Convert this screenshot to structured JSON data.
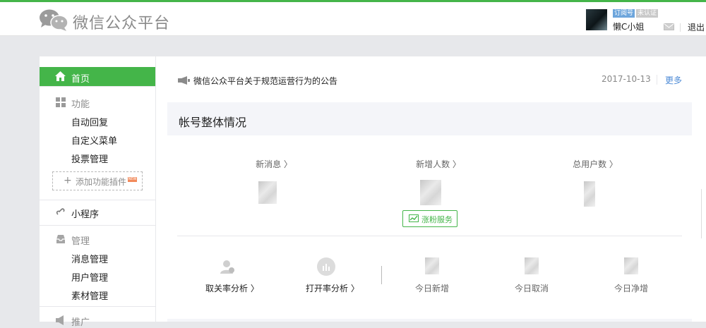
{
  "header": {
    "logo_text": "微信公众平台",
    "account_type_badge": "订阅号",
    "verify_badge": "未认证",
    "username": "懒C小姐",
    "logout_label": "退出"
  },
  "sidebar": {
    "home_label": "首页",
    "sections": [
      {
        "title": "功能",
        "items": [
          "自动回复",
          "自定义菜单",
          "投票管理"
        ]
      },
      {
        "title": "管理",
        "items": [
          "消息管理",
          "用户管理",
          "素材管理"
        ]
      },
      {
        "title": "推广",
        "items": []
      }
    ],
    "add_plugin_label": "添加功能插件",
    "new_tag": "NEW",
    "mini_program_label": "小程序"
  },
  "main": {
    "notice": {
      "text": "微信公众平台关于规范运营行为的公告",
      "date": "2017-10-13",
      "more_label": "更多"
    },
    "overview_title": "帐号整体情况",
    "stats": [
      {
        "label": "新消息 〉"
      },
      {
        "label": "新增人数 〉"
      },
      {
        "label": "总用户数 〉"
      }
    ],
    "fans_button": "涨粉服务",
    "analysis": [
      {
        "label": "取关率分析 〉"
      },
      {
        "label": "打开率分析 〉"
      }
    ],
    "today": [
      {
        "label": "今日新增"
      },
      {
        "label": "今日取消"
      },
      {
        "label": "今日净增"
      }
    ]
  },
  "colors": {
    "brand_green": "#44b549",
    "link_blue": "#4c8ad6"
  }
}
